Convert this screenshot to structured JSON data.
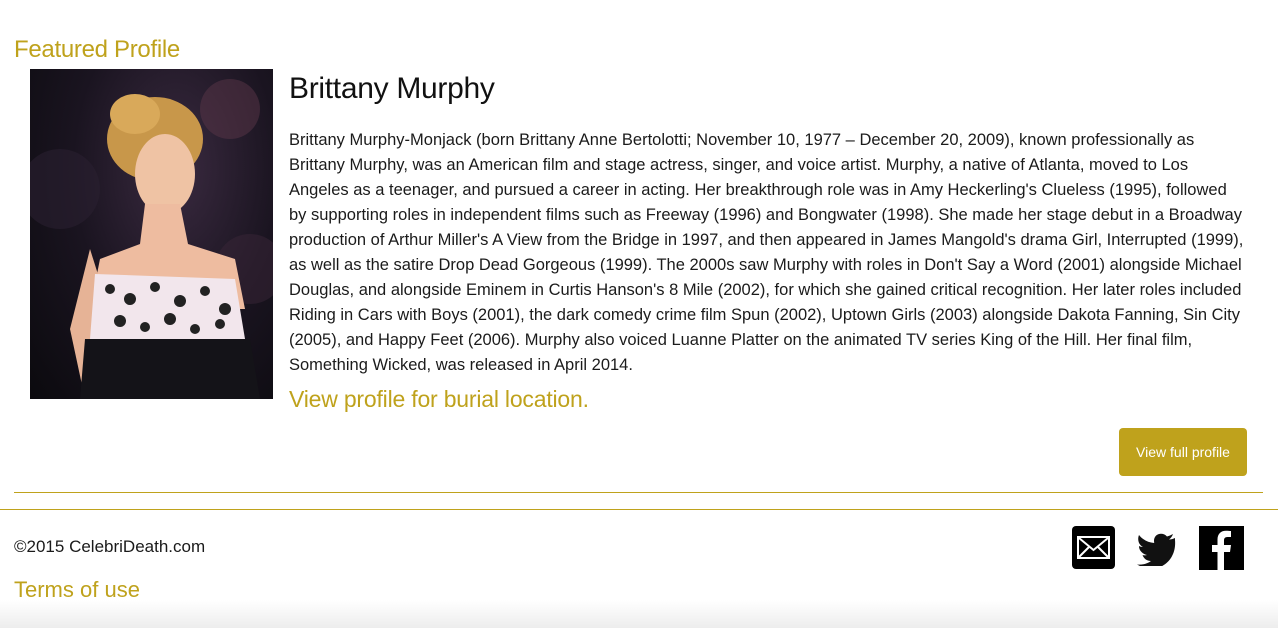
{
  "section": {
    "title": "Featured Profile"
  },
  "profile": {
    "name": "Brittany Murphy",
    "bio": "Brittany Murphy-Monjack (born Brittany Anne Bertolotti; November 10, 1977 – December 20, 2009), known professionally as Brittany Murphy, was an American film and stage actress, singer, and voice artist. Murphy, a native of Atlanta, moved to Los Angeles as a teenager, and pursued a career in acting. Her breakthrough role was in Amy Heckerling's Clueless (1995), followed by supporting roles in independent films such as Freeway (1996) and Bongwater (1998). She made her stage debut in a Broadway production of Arthur Miller's A View from the Bridge in 1997, and then appeared in James Mangold's drama Girl, Interrupted (1999), as well as the satire Drop Dead Gorgeous (1999). The 2000s saw Murphy with roles in Don't Say a Word (2001) alongside Michael Douglas, and alongside Eminem in Curtis Hanson's 8 Mile (2002), for which she gained critical recognition. Her later roles included Riding in Cars with Boys (2001), the dark comedy crime film Spun (2002), Uptown Girls (2003) alongside Dakota Fanning, Sin City (2005), and Happy Feet (2006). Murphy also voiced Luanne Platter on the animated TV series King of the Hill. Her final film, Something Wicked, was released in April 2014.",
    "burial_link": "View profile for burial location.",
    "full_profile_button": "View full profile"
  },
  "footer": {
    "copyright": "©2015 CelebriDeath.com",
    "terms": "Terms of use",
    "social": [
      {
        "icon": "mail-icon"
      },
      {
        "icon": "twitter-icon"
      },
      {
        "icon": "facebook-icon"
      }
    ]
  },
  "colors": {
    "accent": "#bfa21c",
    "text": "#1a1a1a",
    "background": "#ffffff"
  }
}
